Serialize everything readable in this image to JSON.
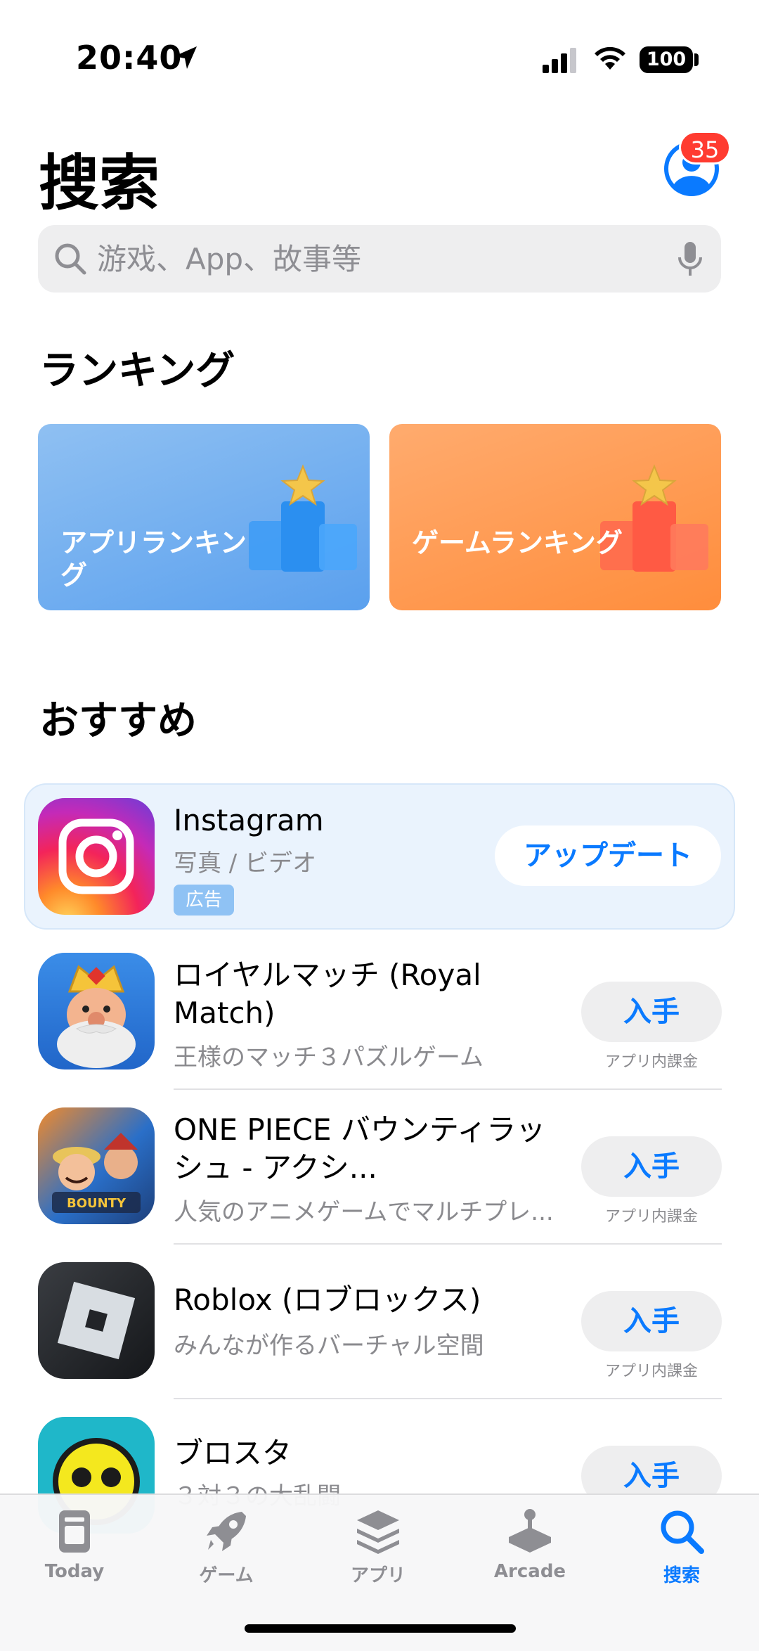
{
  "status_bar": {
    "time": "20:40",
    "battery": "100"
  },
  "header": {
    "title": "搜索",
    "badge_count": "35"
  },
  "search": {
    "placeholder": "游戏、App、故事等"
  },
  "ranking": {
    "title": "ランキング",
    "cards": [
      {
        "label": "アプリランキング",
        "color": "#5aa0ee"
      },
      {
        "label": "ゲームランキング",
        "color": "#ff8d3c"
      }
    ]
  },
  "recommended": {
    "title": "おすすめ",
    "ad": {
      "name": "Instagram",
      "category": "写真 / ビデオ",
      "ad_label": "広告",
      "button": "アップデート"
    },
    "apps": [
      {
        "name": "ロイヤルマッチ (Royal Match)",
        "subtitle": "王様のマッチ３パズルゲーム",
        "button": "入手",
        "note": "アプリ内課金"
      },
      {
        "name": "ONE PIECE バウンティラッシュ - アクシ...",
        "subtitle": "人気のアニメゲームでマルチプレ...",
        "button": "入手",
        "note": "アプリ内課金"
      },
      {
        "name": "Roblox (ロブロックス)",
        "subtitle": "みんなが作るバーチャル空間",
        "button": "入手",
        "note": "アプリ内課金"
      },
      {
        "name": "ブロスタ",
        "subtitle": "３対３の大乱闘",
        "button": "入手"
      }
    ]
  },
  "tab_bar": {
    "tabs": [
      {
        "label": "Today",
        "icon": "today-icon"
      },
      {
        "label": "ゲーム",
        "icon": "rocket-icon"
      },
      {
        "label": "アプリ",
        "icon": "layers-icon"
      },
      {
        "label": "Arcade",
        "icon": "joystick-icon"
      },
      {
        "label": "搜索",
        "icon": "search-icon",
        "active": true
      }
    ],
    "accent": "#0a7aff"
  }
}
